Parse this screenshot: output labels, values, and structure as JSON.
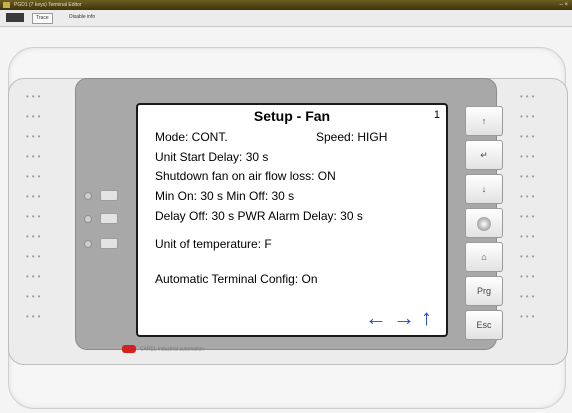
{
  "window": {
    "title": "PGD1 (7 keys) Terminal Editor",
    "controls": "– ×"
  },
  "menu": {
    "tabs": [
      "Trace",
      "Disable info"
    ]
  },
  "screen": {
    "title": "Setup - Fan",
    "page_number": "1",
    "lines": [
      "Mode: CONT.",
      "Speed: HIGH",
      "Unit Start Delay:   30 s",
      "Shutdown fan on air flow loss: ON",
      "Min On: 30   s    Min Off:  30   s",
      "Delay Off:  30 s  PWR Alarm Delay:   30 s",
      "Unit of temperature:  F",
      "Automatic Terminal Config:   On"
    ],
    "nav_arrows": "←→↑"
  },
  "keypad": {
    "keys": [
      {
        "name": "up-key",
        "glyph": "↑"
      },
      {
        "name": "enter-key",
        "glyph": "↵"
      },
      {
        "name": "down-key",
        "glyph": "↓"
      },
      {
        "name": "joystick-key",
        "glyph": ""
      },
      {
        "name": "home-key",
        "glyph": "⌂"
      },
      {
        "name": "prg-key",
        "glyph": "Prg"
      },
      {
        "name": "esc-key",
        "glyph": "Esc"
      }
    ]
  },
  "brand": {
    "text": "CAREL industrial automation"
  }
}
